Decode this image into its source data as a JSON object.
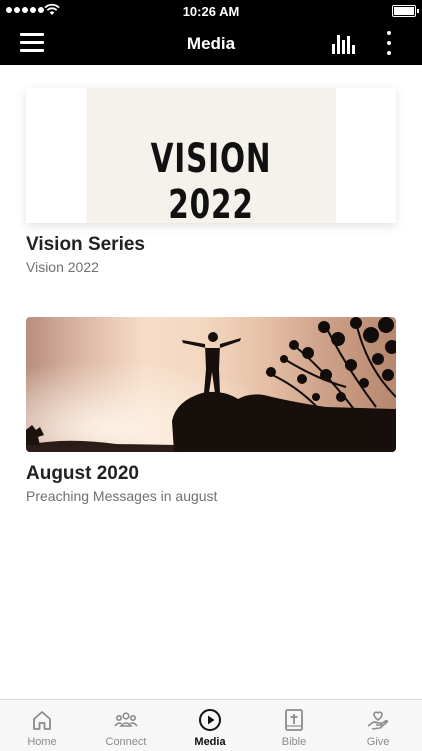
{
  "status_bar": {
    "time": "10:26 AM",
    "signal_icon": "signal-dots-icon",
    "wifi_icon": "wifi-icon",
    "battery_icon": "battery-icon"
  },
  "nav": {
    "title": "Media",
    "menu_icon": "hamburger-menu-icon",
    "audio_icon": "audio-bars-icon",
    "more_icon": "vertical-ellipsis-icon",
    "background_color": "#000000"
  },
  "media_items": [
    {
      "title": "Vision Series",
      "subtitle": "Vision 2022",
      "image_text": "VISION 2022"
    },
    {
      "title": "August 2020",
      "subtitle": "Preaching Messages in august"
    }
  ],
  "tabs": [
    {
      "label": "Home",
      "icon": "home-icon",
      "active": false
    },
    {
      "label": "Connect",
      "icon": "people-group-icon",
      "active": false
    },
    {
      "label": "Media",
      "icon": "play-circle-icon",
      "active": true
    },
    {
      "label": "Bible",
      "icon": "bible-cross-icon",
      "active": false
    },
    {
      "label": "Give",
      "icon": "heart-hand-icon",
      "active": false
    }
  ],
  "colors": {
    "active_tab": "#111111",
    "inactive_tab": "#8b8b8b",
    "tab_bar_background": "#f7f7f7"
  }
}
